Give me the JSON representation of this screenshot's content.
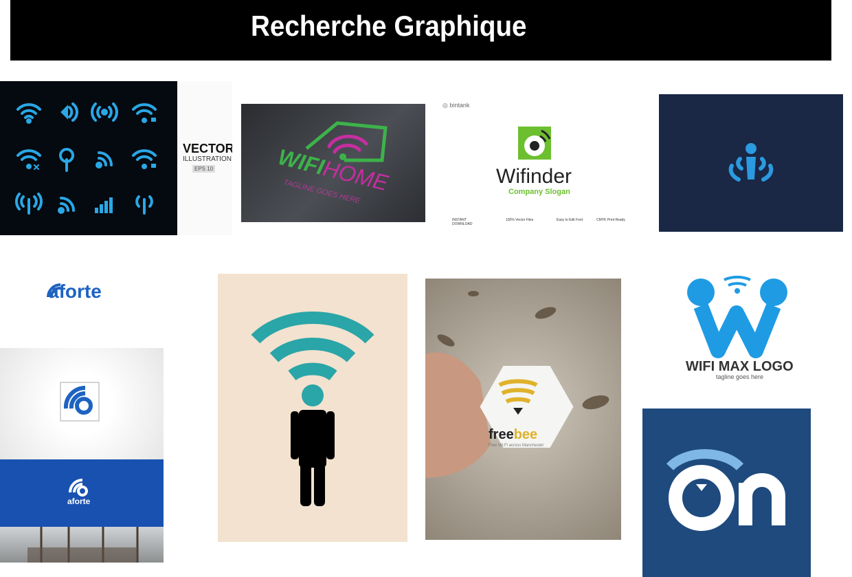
{
  "banner": {
    "title": "Recherche Graphique"
  },
  "tiles": {
    "wifi_icons": {
      "bg": "#050a10",
      "accent": "#2aa7e6"
    },
    "vector_strip": {
      "title": "VECTOR",
      "subtitle": "ILLUSTRATION",
      "badge": "EPS 10"
    },
    "wifi_home": {
      "name_a": "WIFI",
      "name_b": "HOME",
      "tagline": "TAGLINE GOES HERE",
      "accent": "#3db24a",
      "accent2": "#c42ea0"
    },
    "wifinder": {
      "brand": "bintank",
      "name": "Wifinder",
      "slogan": "Company Slogan",
      "features": [
        "INSTANT DOWNLOAD",
        "100% Vector Files",
        "Easy to Edit Font",
        "CMYK Print Ready"
      ],
      "accent": "#6cbf2f"
    },
    "navy_person": {
      "bg": "#1a2745",
      "accent": "#2b9ae0"
    },
    "aforte": {
      "name": "aforte",
      "accent": "#1e63c2",
      "band": "#1951b0"
    },
    "person_wifi": {
      "bg": "#f2e2cf",
      "accent": "#2aa5a8"
    },
    "freebee": {
      "name_a": "free",
      "name_b": "bee",
      "tagline": "Free Wi-Fi across Manchester",
      "accent": "#e0b22a"
    },
    "wifi_max": {
      "name": "WIFI MAX LOGO",
      "tagline": "tagline goes here",
      "accent": "#1f9be4"
    },
    "on_logo": {
      "text": "On",
      "bg": "#1e4a7e",
      "accent": "#7fb7e6"
    }
  }
}
